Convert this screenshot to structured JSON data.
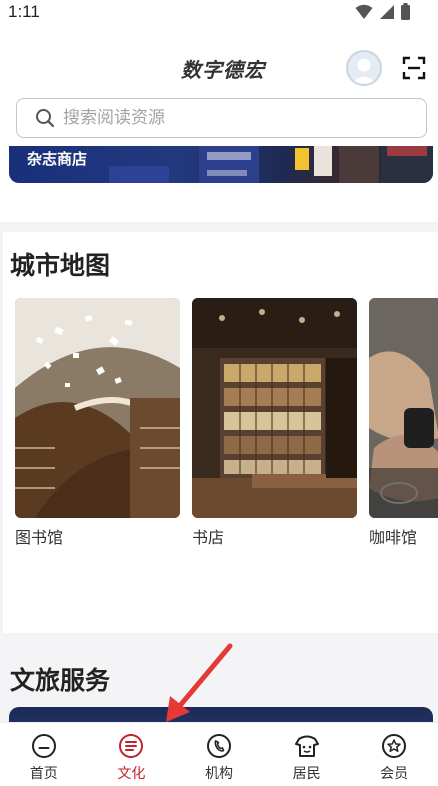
{
  "status_bar": {
    "time": "1:11"
  },
  "header": {
    "title": "数字德宏",
    "search_placeholder": "搜索阅读资源"
  },
  "banner": {
    "label": "杂志商店"
  },
  "city_map": {
    "title": "城市地图",
    "cards": [
      {
        "label": "图书馆"
      },
      {
        "label": "书店"
      },
      {
        "label": "咖啡馆"
      }
    ]
  },
  "travel": {
    "title": "文旅服务"
  },
  "bottom_nav": {
    "items": [
      {
        "label": "首页",
        "icon": "home-icon"
      },
      {
        "label": "文化",
        "icon": "culture-icon",
        "active": true
      },
      {
        "label": "机构",
        "icon": "phone-icon"
      },
      {
        "label": "居民",
        "icon": "resident-icon"
      },
      {
        "label": "会员",
        "icon": "member-star-icon"
      }
    ]
  },
  "colors": {
    "accent": "#c0232c",
    "nav_text": "#333333"
  }
}
